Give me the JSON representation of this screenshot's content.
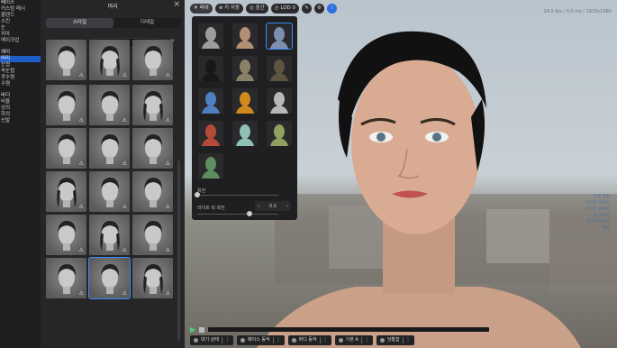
{
  "categories": [
    {
      "label": "페이스",
      "kind": "head"
    },
    {
      "label": "커스텀 메시",
      "kind": "item"
    },
    {
      "label": "블렌드",
      "kind": "item"
    },
    {
      "label": "스킨",
      "kind": "item"
    },
    {
      "label": "눈",
      "kind": "item"
    },
    {
      "label": "치아",
      "kind": "item"
    },
    {
      "label": "메이크업",
      "kind": "item"
    },
    {
      "label": "",
      "kind": "gap"
    },
    {
      "label": "헤어",
      "kind": "head"
    },
    {
      "label": "머리",
      "kind": "selected"
    },
    {
      "label": "눈썹",
      "kind": "item"
    },
    {
      "label": "속눈썹",
      "kind": "item"
    },
    {
      "label": "콧수염",
      "kind": "item"
    },
    {
      "label": "수염",
      "kind": "item"
    },
    {
      "label": "",
      "kind": "gap"
    },
    {
      "label": "바디",
      "kind": "head"
    },
    {
      "label": "비율",
      "kind": "item"
    },
    {
      "label": "상의",
      "kind": "item"
    },
    {
      "label": "하의",
      "kind": "item"
    },
    {
      "label": "신발",
      "kind": "item"
    }
  ],
  "hair_panel": {
    "title": "머리",
    "tabs": [
      "스타일",
      "디테일"
    ],
    "active_tab": 0,
    "color_label": "색상",
    "color_value": "#191618",
    "tile_count": 18,
    "tile_warn_icon": "warning-icon",
    "selected_tile": 16
  },
  "toolbar": {
    "items": [
      {
        "label": "☀ 라이",
        "icon": "light-icon",
        "active": true
      },
      {
        "label": "⊕ 카 자동",
        "icon": "camera-icon",
        "active": false
      },
      {
        "label": "◎ 중간",
        "icon": "view-icon",
        "active": false
      },
      {
        "label": "◷ LOD 0",
        "icon": "lod-icon",
        "active": false
      }
    ],
    "round_buttons": [
      "pencil-icon",
      "settings-icon",
      "info-icon"
    ]
  },
  "light_popup": {
    "presets": 12,
    "colors": [
      "#9d9d9d",
      "#b38f73",
      "#7d8fb0",
      "#181818",
      "#8a8266",
      "#5e5442",
      "#4f7fc0",
      "#d0891e",
      "#b8b8b8",
      "#b44a38",
      "#8fc0b4",
      "#8fa060",
      "#5e8e5e"
    ],
    "selected": 2,
    "rotation_label": "회전",
    "light_rotation_label": "라이트 릭 회전",
    "light_rotation_value": "0.0"
  },
  "viewport_info": "24.0 fps / 0.0 ms / 1920x1080",
  "right_list": [
    "조명 설정",
    "라이트 카메라",
    "라이트 카메라",
    "릭 카메라",
    "라이트 카메라",
    "배경"
  ],
  "bottom_bar": {
    "play_icon": "play-icon",
    "stop_icon": "stop-icon",
    "controls": [
      {
        "label": "대기 상태",
        "icon": "idle-icon"
      },
      {
        "label": "페이스 동작",
        "icon": "face-icon"
      },
      {
        "label": "바디 동작",
        "icon": "body-icon"
      },
      {
        "label": "기본 A",
        "icon": "pose-icon"
      },
      {
        "label": "당황함",
        "icon": "emotion-icon"
      }
    ]
  }
}
